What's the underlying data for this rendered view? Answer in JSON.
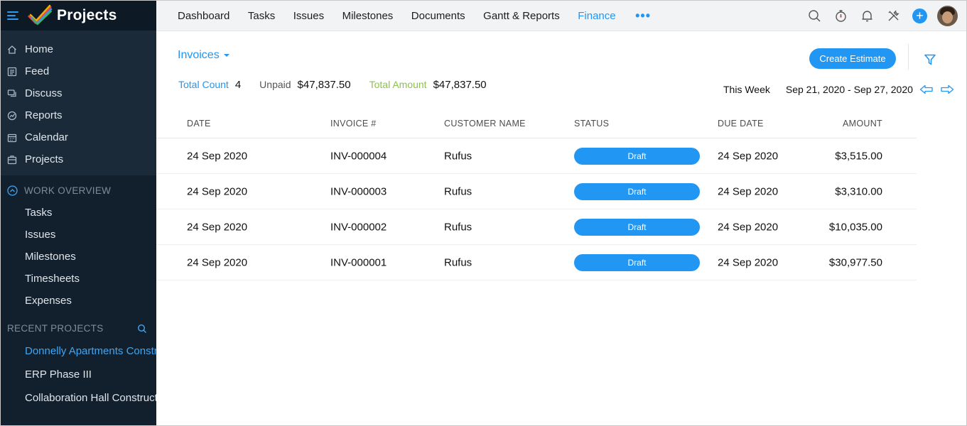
{
  "app": {
    "title": "Projects"
  },
  "sidebar": {
    "main_items": [
      {
        "label": "Home",
        "icon": "home-icon"
      },
      {
        "label": "Feed",
        "icon": "feed-icon"
      },
      {
        "label": "Discuss",
        "icon": "discuss-icon"
      },
      {
        "label": "Reports",
        "icon": "reports-icon"
      },
      {
        "label": "Calendar",
        "icon": "calendar-icon"
      },
      {
        "label": "Projects",
        "icon": "projects-icon"
      }
    ],
    "work_overview": {
      "heading": "WORK OVERVIEW",
      "items": [
        "Tasks",
        "Issues",
        "Milestones",
        "Timesheets",
        "Expenses"
      ]
    },
    "recent_projects": {
      "heading": "RECENT PROJECTS",
      "items": [
        "Donnelly Apartments Construction",
        "ERP Phase III",
        "Collaboration Hall Construction"
      ]
    }
  },
  "topnav": {
    "tabs": [
      "Dashboard",
      "Tasks",
      "Issues",
      "Milestones",
      "Documents",
      "Gantt & Reports",
      "Finance"
    ],
    "active_tab": "Finance",
    "more": "•••",
    "icons": [
      "search-icon",
      "timer-icon",
      "bell-icon",
      "tools-icon",
      "plus-icon",
      "avatar"
    ],
    "plus": "+"
  },
  "invoices": {
    "view_label": "Invoices",
    "create_button": "Create Estimate",
    "summary": {
      "total_count_label": "Total Count",
      "total_count": "4",
      "unpaid_label": "Unpaid",
      "unpaid": "$47,837.50",
      "total_amount_label": "Total Amount",
      "total_amount": "$47,837.50"
    },
    "week": {
      "label": "This Week",
      "range": "Sep 21, 2020 - Sep 27, 2020"
    },
    "columns": [
      "DATE",
      "INVOICE #",
      "CUSTOMER NAME",
      "STATUS",
      "DUE DATE",
      "AMOUNT"
    ],
    "rows": [
      {
        "date": "24 Sep 2020",
        "invoice": "INV-000004",
        "customer": "Rufus",
        "status": "Draft",
        "due": "24 Sep 2020",
        "amount": "$3,515.00"
      },
      {
        "date": "24 Sep 2020",
        "invoice": "INV-000003",
        "customer": "Rufus",
        "status": "Draft",
        "due": "24 Sep 2020",
        "amount": "$3,310.00"
      },
      {
        "date": "24 Sep 2020",
        "invoice": "INV-000002",
        "customer": "Rufus",
        "status": "Draft",
        "due": "24 Sep 2020",
        "amount": "$10,035.00"
      },
      {
        "date": "24 Sep 2020",
        "invoice": "INV-000001",
        "customer": "Rufus",
        "status": "Draft",
        "due": "24 Sep 2020",
        "amount": "$30,977.50"
      }
    ]
  },
  "colors": {
    "accent": "#2196f3",
    "sidebar_bg": "#12202e",
    "total_amount_label": "#8bc34a",
    "active_recent": "#3ea6f5"
  }
}
